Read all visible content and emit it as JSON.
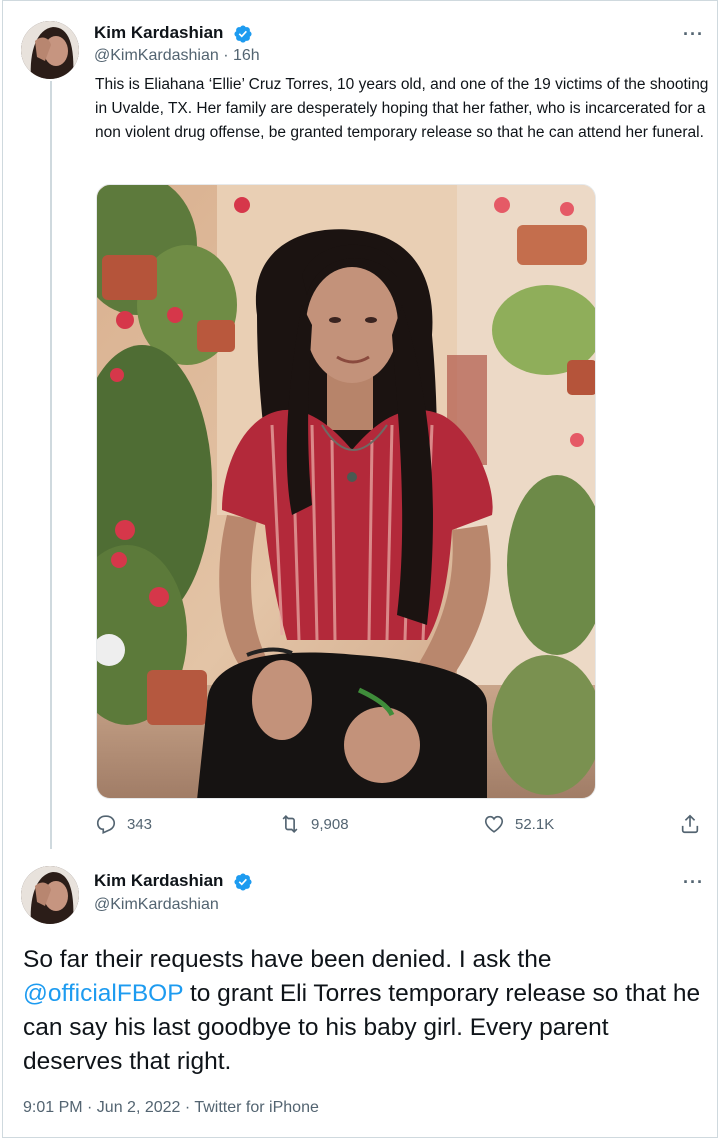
{
  "tweet1": {
    "display_name": "Kim Kardashian",
    "handle": "@KimKardashian",
    "time": "16h",
    "handle_time": "@KimKardashian · 16h",
    "text": "This is Eliahana ‘Ellie’ Cruz Torres, 10 years old, and one of the 19 victims of the shooting in Uvalde, TX. Her family are desperately hoping that her father, who is incarcerated for a non violent drug offense, be granted temporary release so that he can attend her funeral.",
    "replies": "343",
    "retweets": "9,908",
    "likes": "52.1K",
    "icons": [
      "verified-badge-icon",
      "more-icon",
      "reply-icon",
      "retweet-icon",
      "like-icon",
      "share-icon"
    ]
  },
  "tweet2": {
    "display_name": "Kim Kardashian",
    "handle": "@KimKardashian",
    "text_before": "So far their requests have been denied. I ask the ",
    "mention": "@officialFBOP",
    "text_after": " to grant Eli Torres temporary release so that he can say his last goodbye to his baby girl. Every parent deserves that right.",
    "meta": "9:01 PM · Jun 2, 2022 · Twitter for iPhone"
  },
  "colors": {
    "accent": "#1d9bf0",
    "text": "#0f1419",
    "secondary": "#536471",
    "border": "#cfd9de"
  }
}
